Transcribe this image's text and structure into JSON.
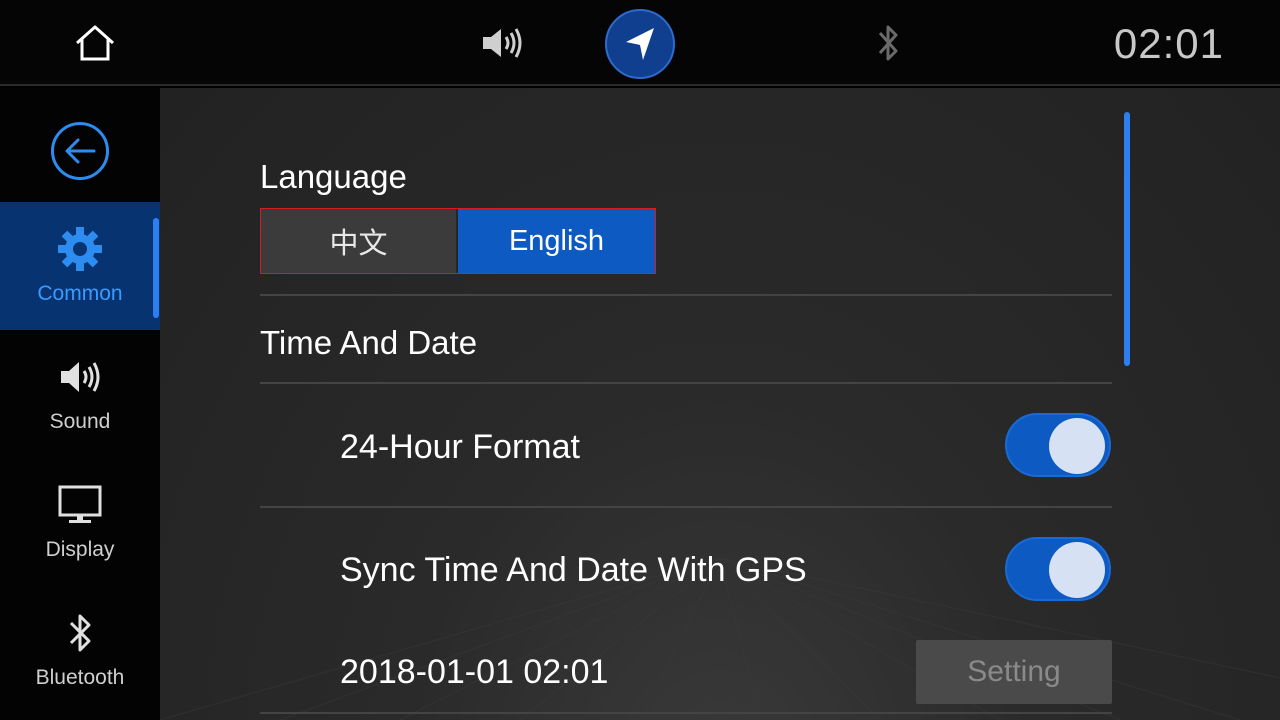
{
  "topbar": {
    "icons": [
      "home-icon",
      "volume-icon",
      "navigation-arrow-icon",
      "bluetooth-icon"
    ],
    "clock": "02:01"
  },
  "sidebar": {
    "items": [
      {
        "label": "Common",
        "icon": "gear-icon",
        "active": true
      },
      {
        "label": "Sound",
        "icon": "speaker-icon",
        "active": false
      },
      {
        "label": "Display",
        "icon": "monitor-icon",
        "active": false
      },
      {
        "label": "Bluetooth",
        "icon": "bluetooth-icon",
        "active": false
      }
    ]
  },
  "main": {
    "language_title": "Language",
    "language_options": [
      "中文",
      "English"
    ],
    "language_selected": "English",
    "time_title": "Time And Date",
    "rows": [
      {
        "label": "24-Hour Format",
        "toggle": true
      },
      {
        "label": "Sync Time And Date With GPS",
        "toggle": true
      }
    ],
    "datetime": "2018-01-01 02:01",
    "setting_label": "Setting"
  },
  "colors": {
    "accent": "#0d5bc2",
    "active_sidebar": "#073370",
    "highlight": "#2d8cf0"
  }
}
